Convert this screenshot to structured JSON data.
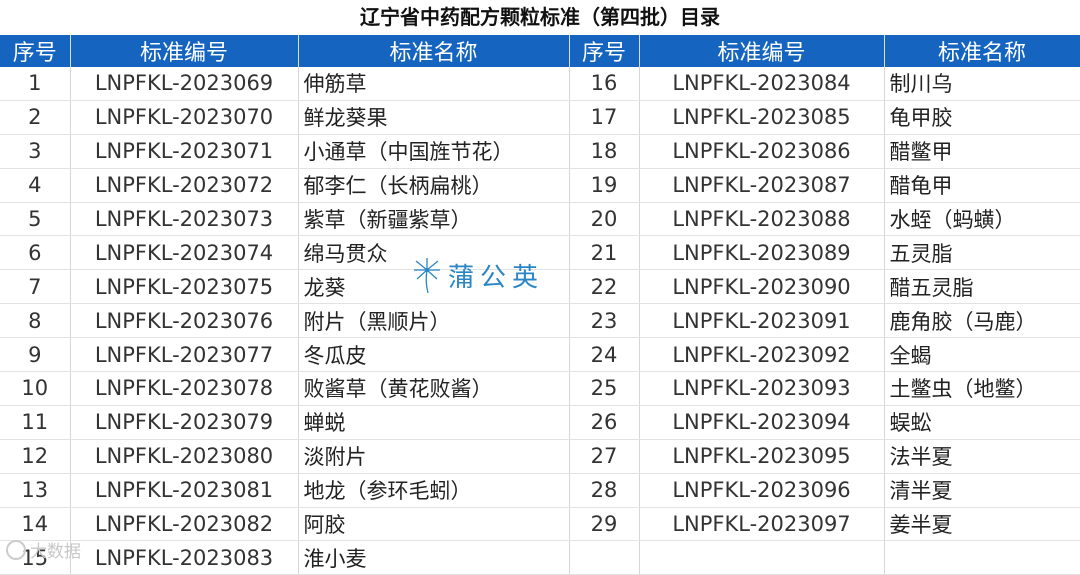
{
  "title": "辽宁省中药配方颗粒标准（第四批）目录",
  "headers": [
    "序号",
    "标准编号",
    "标准名称",
    "序号",
    "标准编号",
    "标准名称"
  ],
  "left_rows": [
    {
      "no": "1",
      "code": "LNPFKL-2023069",
      "name": "伸筋草"
    },
    {
      "no": "2",
      "code": "LNPFKL-2023070",
      "name": "鲜龙葵果"
    },
    {
      "no": "3",
      "code": "LNPFKL-2023071",
      "name": "小通草（中国旌节花）"
    },
    {
      "no": "4",
      "code": "LNPFKL-2023072",
      "name": "郁李仁（长柄扁桃）"
    },
    {
      "no": "5",
      "code": "LNPFKL-2023073",
      "name": "紫草（新疆紫草）"
    },
    {
      "no": "6",
      "code": "LNPFKL-2023074",
      "name": "绵马贯众"
    },
    {
      "no": "7",
      "code": "LNPFKL-2023075",
      "name": "龙葵"
    },
    {
      "no": "8",
      "code": "LNPFKL-2023076",
      "name": "附片（黑顺片）"
    },
    {
      "no": "9",
      "code": "LNPFKL-2023077",
      "name": "冬瓜皮"
    },
    {
      "no": "10",
      "code": "LNPFKL-2023078",
      "name": "败酱草（黄花败酱）"
    },
    {
      "no": "11",
      "code": "LNPFKL-2023079",
      "name": "蝉蜕"
    },
    {
      "no": "12",
      "code": "LNPFKL-2023080",
      "name": "淡附片"
    },
    {
      "no": "13",
      "code": "LNPFKL-2023081",
      "name": "地龙（参环毛蚓）"
    },
    {
      "no": "14",
      "code": "LNPFKL-2023082",
      "name": "阿胶"
    },
    {
      "no": "15",
      "code": "LNPFKL-2023083",
      "name": "淮小麦"
    }
  ],
  "right_rows": [
    {
      "no": "16",
      "code": "LNPFKL-2023084",
      "name": "制川乌"
    },
    {
      "no": "17",
      "code": "LNPFKL-2023085",
      "name": "龟甲胶"
    },
    {
      "no": "18",
      "code": "LNPFKL-2023086",
      "name": "醋鳖甲"
    },
    {
      "no": "19",
      "code": "LNPFKL-2023087",
      "name": "醋龟甲"
    },
    {
      "no": "20",
      "code": "LNPFKL-2023088",
      "name": "水蛭（蚂蟥）"
    },
    {
      "no": "21",
      "code": "LNPFKL-2023089",
      "name": "五灵脂"
    },
    {
      "no": "22",
      "code": "LNPFKL-2023090",
      "name": "醋五灵脂"
    },
    {
      "no": "23",
      "code": "LNPFKL-2023091",
      "name": "鹿角胶（马鹿）"
    },
    {
      "no": "24",
      "code": "LNPFKL-2023092",
      "name": "全蝎"
    },
    {
      "no": "25",
      "code": "LNPFKL-2023093",
      "name": "土鳖虫（地鳖）"
    },
    {
      "no": "26",
      "code": "LNPFKL-2023094",
      "name": "蜈蚣"
    },
    {
      "no": "27",
      "code": "LNPFKL-2023095",
      "name": "法半夏"
    },
    {
      "no": "28",
      "code": "LNPFKL-2023096",
      "name": "清半夏"
    },
    {
      "no": "29",
      "code": "LNPFKL-2023097",
      "name": "姜半夏"
    },
    {
      "no": "",
      "code": "",
      "name": ""
    }
  ],
  "watermark_text": "蒲公英",
  "corner_watermark_text": "大数据"
}
